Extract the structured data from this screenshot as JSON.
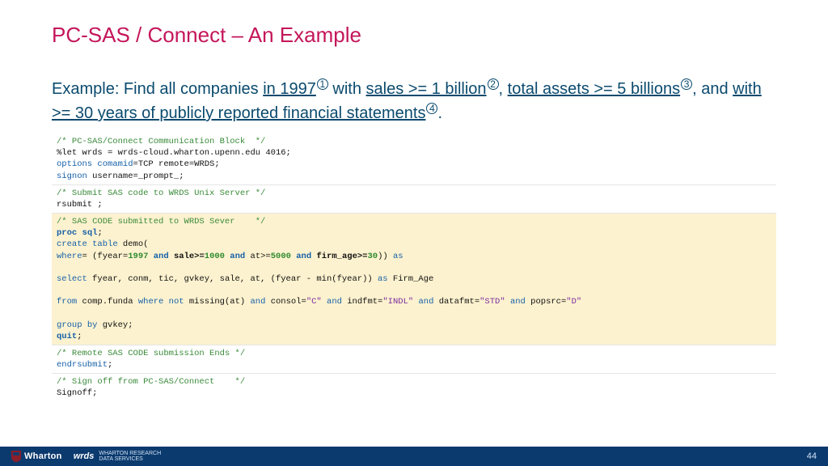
{
  "title": "PC-SAS / Connect – An Example",
  "example": {
    "prefix": "Example: Find all companies ",
    "p1": "in 1997",
    "n1": "1",
    "mid1": " with ",
    "p2": "sales >= 1 billion",
    "n2": "2",
    "mid2": ", ",
    "p3": "total assets >= 5 billions",
    "n3": "3",
    "mid3": ", and ",
    "p4": "with >= 30 years of publicly reported financial statements",
    "n4": "4",
    "suffix": "."
  },
  "code": {
    "b1": {
      "c": "/* PC-SAS/Connect Communication Block  */",
      "l1a": "%let",
      "l1b": " wrds = wrds-cloud.wharton.upenn.edu 4016;",
      "l2a": "options",
      "l2b": " comamid",
      "l2c": "=TCP remote=WRDS;",
      "l3a": "signon",
      "l3b": " username=_prompt_;"
    },
    "b2": {
      "c": "/* Submit SAS code to WRDS Unix Server */",
      "l1": "rsubmit ;"
    },
    "b3": {
      "c": "/* SAS CODE submitted to WRDS Sever    */",
      "l1a": "proc",
      "l1b": " sql",
      "l1c": ";",
      "l2a": "create",
      "l2b": " table",
      "l2c": " demo(",
      "l3a": "where",
      "l3b": "= (fyear=",
      "l3c": "1997",
      "l3d": " and",
      "l3e": " sale>=",
      "l3f": "1000",
      "l3g": " and",
      "l3h": " at>=",
      "l3i": "5000",
      "l3j": " and",
      "l3k": " firm_age>=",
      "l3l": "30",
      "l3m": ")) ",
      "l3n": "as",
      "l4a": "select",
      "l4b": " fyear, conm, tic, gvkey, sale, at, (fyear - min(fyear)) ",
      "l4c": "as",
      "l4d": " Firm_Age",
      "l5a": "from",
      "l5b": " comp.funda ",
      "l5c": "where",
      "l5d": " not",
      "l5e": " missing(at) ",
      "l5f": "and",
      "l5g": " consol=",
      "l5h": "\"C\"",
      "l5i": " and",
      "l5j": " indfmt=",
      "l5k": "\"INDL\"",
      "l5l": " and",
      "l5m": " datafmt=",
      "l5n": "\"STD\"",
      "l5o": " and",
      "l5p": " popsrc=",
      "l5q": "\"D\"",
      "l6a": "group",
      "l6b": " by",
      "l6c": " gvkey;",
      "l7a": "quit",
      "l7b": ";"
    },
    "b4": {
      "c": "/* Remote SAS CODE submission Ends */",
      "l1a": "endrsubmit",
      "l1b": ";"
    },
    "b5": {
      "c": "/* Sign off from PC-SAS/Connect    */",
      "l1": "Signoff;"
    }
  },
  "footer": {
    "wharton": "Wharton",
    "wrds": "wrds",
    "wrds_sub1": "WHARTON RESEARCH",
    "wrds_sub2": "DATA SERVICES",
    "page": "44"
  }
}
